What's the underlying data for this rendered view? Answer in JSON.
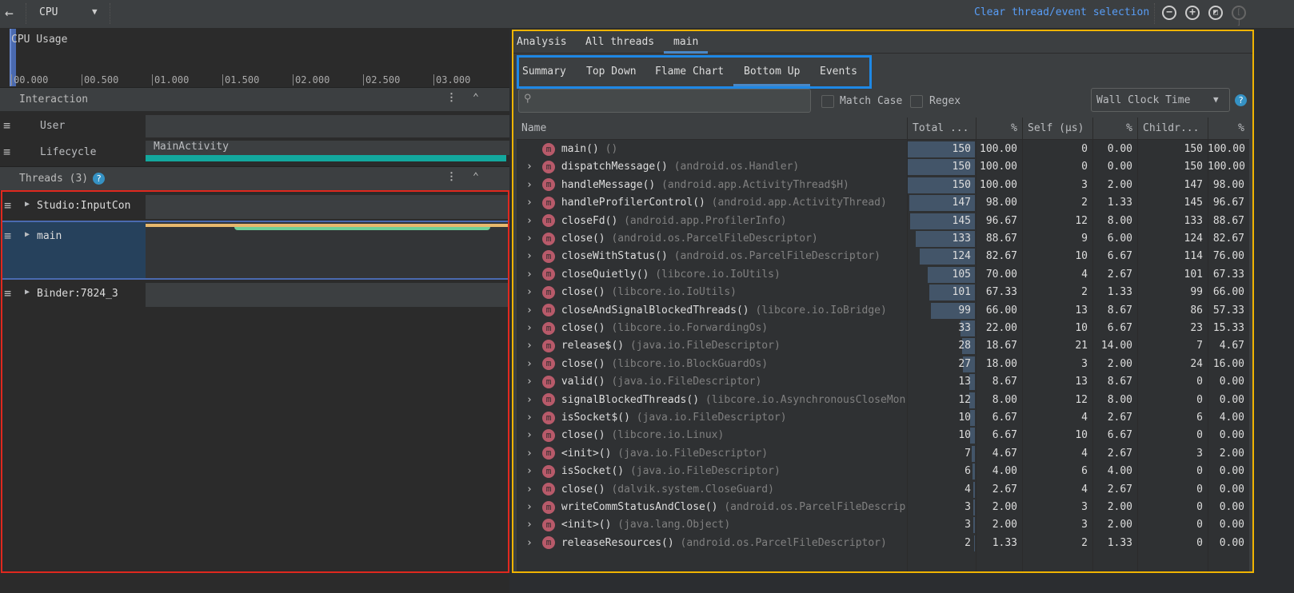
{
  "toolbar": {
    "back_icon": "arrow-left-icon",
    "profiler_select": "CPU",
    "clear_selection": "Clear thread/event selection",
    "zoom_out_icon": "zoom-out-icon",
    "zoom_in_icon": "zoom-in-icon",
    "reset_zoom_icon": "reset-zoom-icon",
    "attach_icon": "frame-icon"
  },
  "cpu_usage": {
    "title": "CPU Usage",
    "ticks": [
      "00.000",
      "00.500",
      "01.000",
      "01.500",
      "02.000",
      "02.500",
      "03.000"
    ]
  },
  "interaction": {
    "title": "Interaction",
    "rows": [
      {
        "label": "User"
      },
      {
        "label": "Lifecycle",
        "event": "MainActivity"
      }
    ]
  },
  "threads": {
    "title": "Threads (3)",
    "items": [
      {
        "label": "Studio:InputCon"
      },
      {
        "label": "main"
      },
      {
        "label": "Binder:7824_3"
      }
    ]
  },
  "analysis": {
    "tabs": [
      {
        "label": "Analysis"
      },
      {
        "label": "All threads"
      },
      {
        "label": "main",
        "active": true
      }
    ],
    "subtabs": [
      {
        "label": "Summary"
      },
      {
        "label": "Top Down"
      },
      {
        "label": "Flame Chart"
      },
      {
        "label": "Bottom Up",
        "active": true
      },
      {
        "label": "Events"
      }
    ],
    "search_placeholder": "",
    "match_case": "Match Case",
    "regex": "Regex",
    "clock": "Wall Clock Time",
    "help_icon": "help-icon",
    "columns": [
      "Name",
      "Total ...",
      "%",
      "Self (µs)",
      "%",
      "Childr...",
      "%"
    ],
    "rows": [
      {
        "name": "main()",
        "pkg": "()",
        "total": 150,
        "total_pct": "100.00",
        "self": 0,
        "self_pct": "0.00",
        "children": 150,
        "children_pct": "100.00",
        "expandable": false
      },
      {
        "name": "dispatchMessage()",
        "pkg": "(android.os.Handler)",
        "total": 150,
        "total_pct": "100.00",
        "self": 0,
        "self_pct": "0.00",
        "children": 150,
        "children_pct": "100.00"
      },
      {
        "name": "handleMessage()",
        "pkg": "(android.app.ActivityThread$H)",
        "total": 150,
        "total_pct": "100.00",
        "self": 3,
        "self_pct": "2.00",
        "children": 147,
        "children_pct": "98.00"
      },
      {
        "name": "handleProfilerControl()",
        "pkg": "(android.app.ActivityThread)",
        "total": 147,
        "total_pct": "98.00",
        "self": 2,
        "self_pct": "1.33",
        "children": 145,
        "children_pct": "96.67"
      },
      {
        "name": "closeFd()",
        "pkg": "(android.app.ProfilerInfo)",
        "total": 145,
        "total_pct": "96.67",
        "self": 12,
        "self_pct": "8.00",
        "children": 133,
        "children_pct": "88.67"
      },
      {
        "name": "close()",
        "pkg": "(android.os.ParcelFileDescriptor)",
        "total": 133,
        "total_pct": "88.67",
        "self": 9,
        "self_pct": "6.00",
        "children": 124,
        "children_pct": "82.67"
      },
      {
        "name": "closeWithStatus()",
        "pkg": "(android.os.ParcelFileDescriptor)",
        "total": 124,
        "total_pct": "82.67",
        "self": 10,
        "self_pct": "6.67",
        "children": 114,
        "children_pct": "76.00"
      },
      {
        "name": "closeQuietly()",
        "pkg": "(libcore.io.IoUtils)",
        "total": 105,
        "total_pct": "70.00",
        "self": 4,
        "self_pct": "2.67",
        "children": 101,
        "children_pct": "67.33"
      },
      {
        "name": "close()",
        "pkg": "(libcore.io.IoUtils)",
        "total": 101,
        "total_pct": "67.33",
        "self": 2,
        "self_pct": "1.33",
        "children": 99,
        "children_pct": "66.00"
      },
      {
        "name": "closeAndSignalBlockedThreads()",
        "pkg": "(libcore.io.IoBridge)",
        "total": 99,
        "total_pct": "66.00",
        "self": 13,
        "self_pct": "8.67",
        "children": 86,
        "children_pct": "57.33"
      },
      {
        "name": "close()",
        "pkg": "(libcore.io.ForwardingOs)",
        "total": 33,
        "total_pct": "22.00",
        "self": 10,
        "self_pct": "6.67",
        "children": 23,
        "children_pct": "15.33"
      },
      {
        "name": "release$()",
        "pkg": "(java.io.FileDescriptor)",
        "total": 28,
        "total_pct": "18.67",
        "self": 21,
        "self_pct": "14.00",
        "children": 7,
        "children_pct": "4.67"
      },
      {
        "name": "close()",
        "pkg": "(libcore.io.BlockGuardOs)",
        "total": 27,
        "total_pct": "18.00",
        "self": 3,
        "self_pct": "2.00",
        "children": 24,
        "children_pct": "16.00"
      },
      {
        "name": "valid()",
        "pkg": "(java.io.FileDescriptor)",
        "total": 13,
        "total_pct": "8.67",
        "self": 13,
        "self_pct": "8.67",
        "children": 0,
        "children_pct": "0.00"
      },
      {
        "name": "signalBlockedThreads()",
        "pkg": "(libcore.io.AsynchronousCloseMoni",
        "total": 12,
        "total_pct": "8.00",
        "self": 12,
        "self_pct": "8.00",
        "children": 0,
        "children_pct": "0.00"
      },
      {
        "name": "isSocket$()",
        "pkg": "(java.io.FileDescriptor)",
        "total": 10,
        "total_pct": "6.67",
        "self": 4,
        "self_pct": "2.67",
        "children": 6,
        "children_pct": "4.00"
      },
      {
        "name": "close()",
        "pkg": "(libcore.io.Linux)",
        "total": 10,
        "total_pct": "6.67",
        "self": 10,
        "self_pct": "6.67",
        "children": 0,
        "children_pct": "0.00"
      },
      {
        "name": "<init>()",
        "pkg": "(java.io.FileDescriptor)",
        "total": 7,
        "total_pct": "4.67",
        "self": 4,
        "self_pct": "2.67",
        "children": 3,
        "children_pct": "2.00"
      },
      {
        "name": "isSocket()",
        "pkg": "(java.io.FileDescriptor)",
        "total": 6,
        "total_pct": "4.00",
        "self": 6,
        "self_pct": "4.00",
        "children": 0,
        "children_pct": "0.00"
      },
      {
        "name": "close()",
        "pkg": "(dalvik.system.CloseGuard)",
        "total": 4,
        "total_pct": "2.67",
        "self": 4,
        "self_pct": "2.67",
        "children": 0,
        "children_pct": "0.00"
      },
      {
        "name": "writeCommStatusAndClose()",
        "pkg": "(android.os.ParcelFileDescript",
        "total": 3,
        "total_pct": "2.00",
        "self": 3,
        "self_pct": "2.00",
        "children": 0,
        "children_pct": "0.00"
      },
      {
        "name": "<init>()",
        "pkg": "(java.lang.Object)",
        "total": 3,
        "total_pct": "2.00",
        "self": 3,
        "self_pct": "2.00",
        "children": 0,
        "children_pct": "0.00"
      },
      {
        "name": "releaseResources()",
        "pkg": "(android.os.ParcelFileDescriptor)",
        "total": 2,
        "total_pct": "1.33",
        "self": 2,
        "self_pct": "1.33",
        "children": 0,
        "children_pct": "0.00"
      }
    ]
  },
  "colors": {
    "accent": "#589df6",
    "highlight_border": "#f0b400",
    "threads_border": "#e0281e",
    "subtab_border": "#1e88e5",
    "lifecycle": "#13a89e",
    "method_badge": "#b85a6a"
  }
}
